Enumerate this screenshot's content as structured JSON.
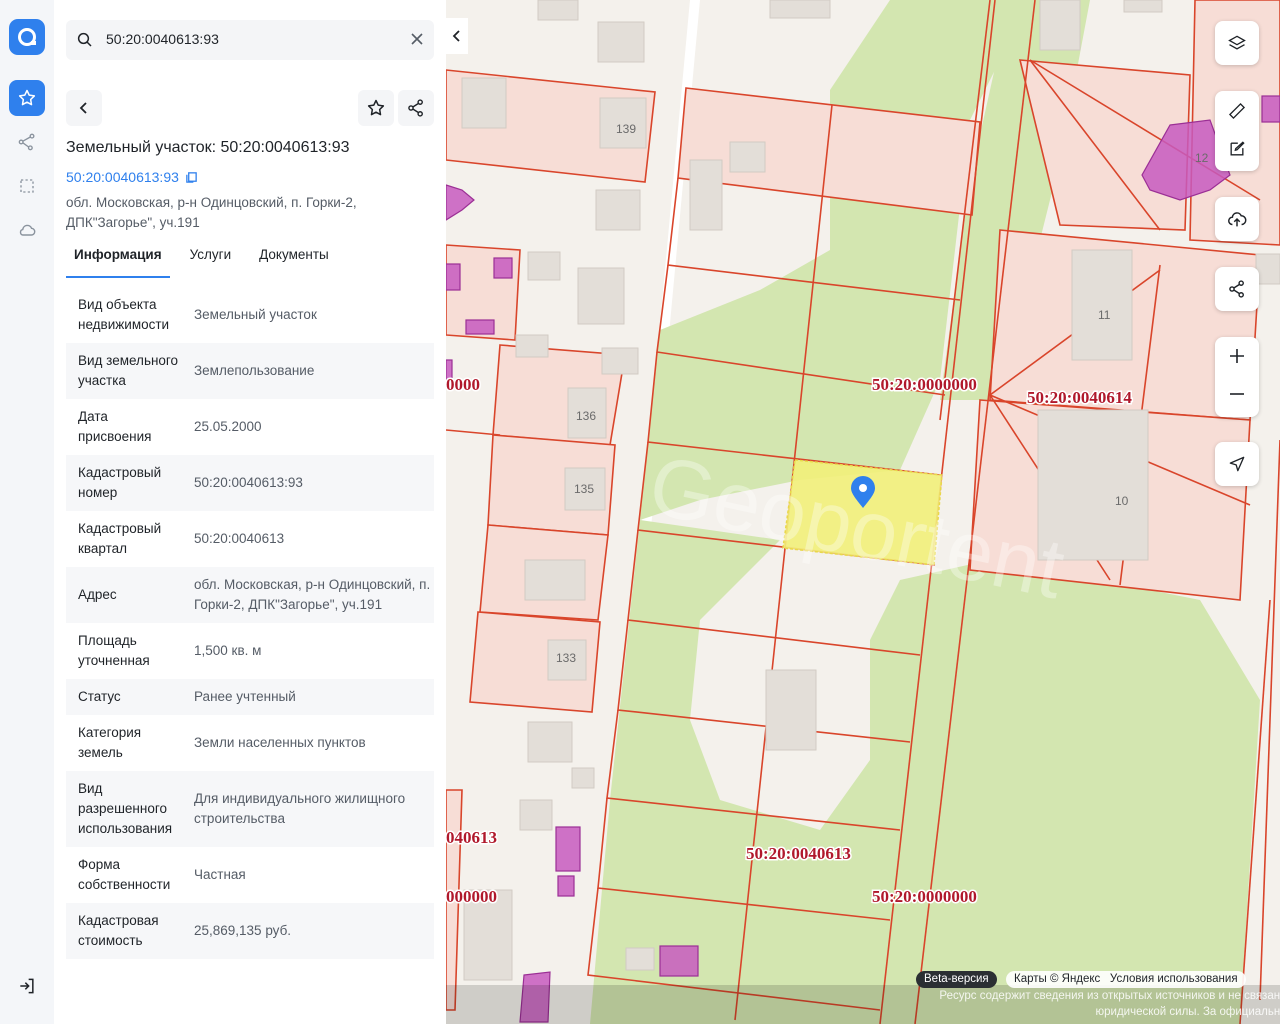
{
  "search": {
    "value": "50:20:0040613:93"
  },
  "panel": {
    "title": "Земельный участок: 50:20:0040613:93",
    "cad_link": "50:20:0040613:93",
    "address": "обл. Московская, р-н Одинцовский, п. Горки-2, ДПК\"Загорье\", уч.191",
    "tabs": [
      "Информация",
      "Услуги",
      "Документы"
    ],
    "rows": [
      {
        "key": "Вид объекта недвижимости",
        "value": "Земельный участок"
      },
      {
        "key": "Вид земельного участка",
        "value": "Землепользование"
      },
      {
        "key": "Дата присвоения",
        "value": "25.05.2000"
      },
      {
        "key": "Кадастровый номер",
        "value": "50:20:0040613:93"
      },
      {
        "key": "Кадастровый квартал",
        "value": "50:20:0040613"
      },
      {
        "key": "Адрес",
        "value": "обл. Московская, р-н Одинцовский, п. Горки-2, ДПК\"Загорье\", уч.191"
      },
      {
        "key": "Площадь уточненная",
        "value": "1,500 кв. м"
      },
      {
        "key": "Статус",
        "value": "Ранее учтенный"
      },
      {
        "key": "Категория земель",
        "value": "Земли населенных пунктов"
      },
      {
        "key": "Вид разрешенного использования",
        "value": "Для индивидуального жилищного строительства"
      },
      {
        "key": "Форма собственности",
        "value": "Частная"
      },
      {
        "key": "Кадастровая стоимость",
        "value": "25,869,135 руб."
      }
    ]
  },
  "map": {
    "labels": {
      "q_0000000_center": "50:20:0000000",
      "q_0040614": "50:20:0040614",
      "q_0040613_bottom": "50:20:0040613",
      "q_0000000_bottom": "50:20:0000000",
      "left_cut_1": "0000",
      "left_cut_2": "040613",
      "left_cut_3": "000000"
    },
    "house_numbers": {
      "h139": "139",
      "h136": "136",
      "h135": "135",
      "h133": "133",
      "h11": "11",
      "h10": "10",
      "h12": "12"
    },
    "watermark": "Geoportent",
    "attribution": {
      "beta": "Beta-версия",
      "maps": "Карты © Яндекс",
      "terms": "Условия использования"
    },
    "disclaimer": "Ресурс содержит сведения из открытых источников и не связан с Росреестром. Вся информация носит справочный характер и не имеет юридической силы. За официальными сведениями обращайтесь в Росреестр."
  },
  "colors": {
    "accent": "#2f80ed",
    "parcel_line": "#d9452b",
    "green": "#d3e6b0",
    "selected": "#f2ef7a",
    "building_pink": "#c75bc0"
  }
}
